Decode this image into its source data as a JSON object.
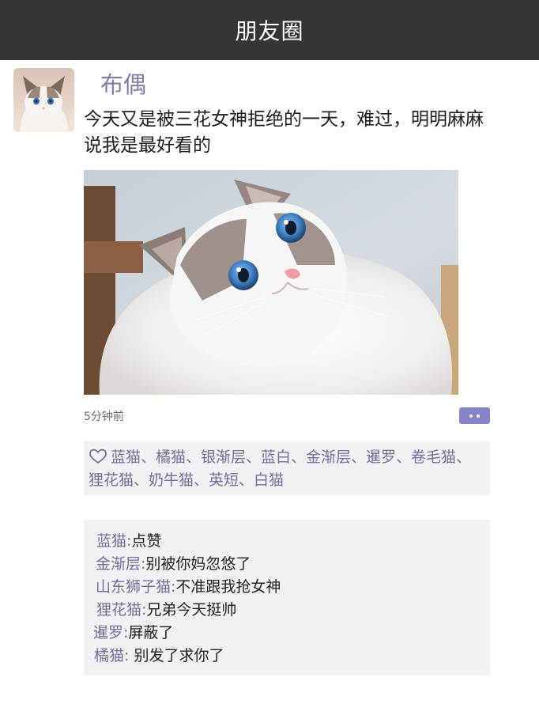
{
  "header": {
    "title": "朋友圈"
  },
  "post": {
    "author": "布偶",
    "text": "今天又是被三花女神拒绝的一天，难过，明明麻麻说我是最好看的",
    "time": "5分钟前",
    "likes": "蓝猫、橘猫、银渐层、蓝白、金渐层、暹罗、卷毛猫、狸花猫、奶牛猫、英短、白猫",
    "comments": [
      {
        "name": "蓝猫:",
        "text": "点赞"
      },
      {
        "name": "金渐层:",
        "text": "别被你妈忽悠了"
      },
      {
        "name": "山东狮子猫:",
        "text": "不准跟我抢女神"
      },
      {
        "name": "狸花猫:",
        "text": "兄弟今天挺帅"
      },
      {
        "name": "暹罗:",
        "text": "屏蔽了"
      },
      {
        "name": "橘猫:",
        "text": " 别发了求你了"
      }
    ]
  },
  "colors": {
    "topbar": "#353535",
    "name_color": "#6f6f98",
    "more_button": "#8884c8",
    "panel_bg": "#f2f2f6"
  },
  "icons": [
    "heart-icon",
    "more-dots-icon"
  ]
}
